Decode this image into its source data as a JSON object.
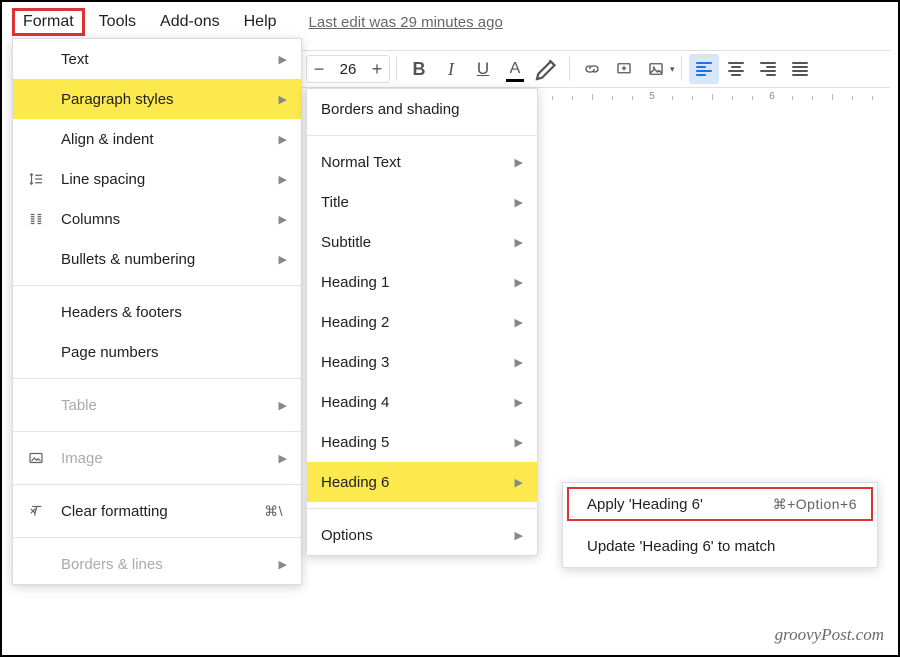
{
  "menubar": {
    "format": "Format",
    "tools": "Tools",
    "addons": "Add-ons",
    "help": "Help",
    "edit_status": "Last edit was 29 minutes ago"
  },
  "toolbar": {
    "font_size": "26",
    "bold": "B",
    "italic": "I",
    "underline": "U",
    "textcolor_letter": "A"
  },
  "ruler": {
    "unit5": "5",
    "unit6": "6"
  },
  "format_menu": {
    "text": "Text",
    "paragraph_styles": "Paragraph styles",
    "align_indent": "Align & indent",
    "line_spacing": "Line spacing",
    "columns": "Columns",
    "bullets_numbering": "Bullets & numbering",
    "headers_footers": "Headers & footers",
    "page_numbers": "Page numbers",
    "table": "Table",
    "image": "Image",
    "clear_formatting": "Clear formatting",
    "clear_formatting_shortcut": "⌘\\",
    "borders_lines": "Borders & lines"
  },
  "pstyles_menu": {
    "borders_shading": "Borders and shading",
    "normal_text": "Normal Text",
    "title": "Title",
    "subtitle": "Subtitle",
    "h1": "Heading 1",
    "h2": "Heading 2",
    "h3": "Heading 3",
    "h4": "Heading 4",
    "h5": "Heading 5",
    "h6": "Heading 6",
    "options": "Options"
  },
  "heading6_menu": {
    "apply": "Apply 'Heading 6'",
    "apply_shortcut": "⌘+Option+6",
    "update": "Update 'Heading 6' to match"
  },
  "watermark": "groovyPost.com"
}
